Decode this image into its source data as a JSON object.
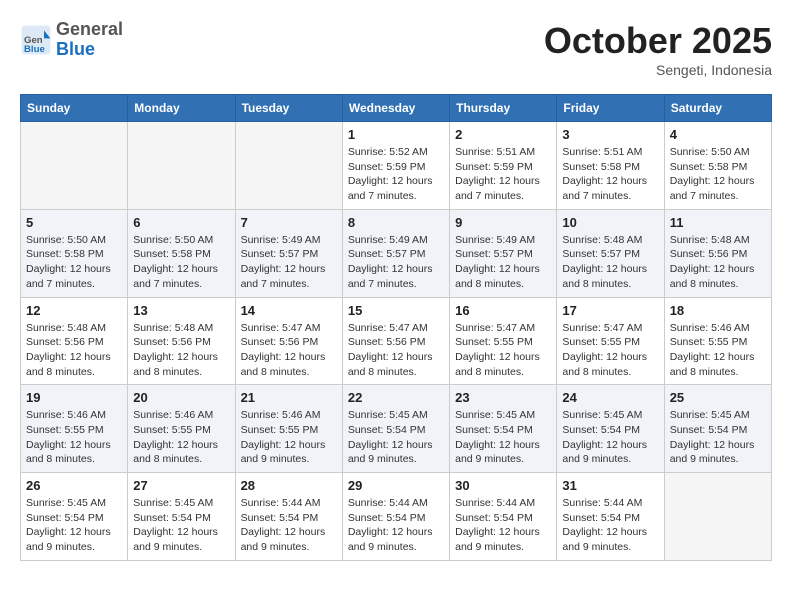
{
  "header": {
    "logo": {
      "general": "General",
      "blue": "Blue"
    },
    "title": "October 2025",
    "subtitle": "Sengeti, Indonesia"
  },
  "weekdays": [
    "Sunday",
    "Monday",
    "Tuesday",
    "Wednesday",
    "Thursday",
    "Friday",
    "Saturday"
  ],
  "weeks": [
    {
      "shaded": false,
      "days": [
        {
          "day": "",
          "info": ""
        },
        {
          "day": "",
          "info": ""
        },
        {
          "day": "",
          "info": ""
        },
        {
          "day": "1",
          "info": "Sunrise: 5:52 AM\nSunset: 5:59 PM\nDaylight: 12 hours\nand 7 minutes."
        },
        {
          "day": "2",
          "info": "Sunrise: 5:51 AM\nSunset: 5:59 PM\nDaylight: 12 hours\nand 7 minutes."
        },
        {
          "day": "3",
          "info": "Sunrise: 5:51 AM\nSunset: 5:58 PM\nDaylight: 12 hours\nand 7 minutes."
        },
        {
          "day": "4",
          "info": "Sunrise: 5:50 AM\nSunset: 5:58 PM\nDaylight: 12 hours\nand 7 minutes."
        }
      ]
    },
    {
      "shaded": true,
      "days": [
        {
          "day": "5",
          "info": "Sunrise: 5:50 AM\nSunset: 5:58 PM\nDaylight: 12 hours\nand 7 minutes."
        },
        {
          "day": "6",
          "info": "Sunrise: 5:50 AM\nSunset: 5:58 PM\nDaylight: 12 hours\nand 7 minutes."
        },
        {
          "day": "7",
          "info": "Sunrise: 5:49 AM\nSunset: 5:57 PM\nDaylight: 12 hours\nand 7 minutes."
        },
        {
          "day": "8",
          "info": "Sunrise: 5:49 AM\nSunset: 5:57 PM\nDaylight: 12 hours\nand 7 minutes."
        },
        {
          "day": "9",
          "info": "Sunrise: 5:49 AM\nSunset: 5:57 PM\nDaylight: 12 hours\nand 8 minutes."
        },
        {
          "day": "10",
          "info": "Sunrise: 5:48 AM\nSunset: 5:57 PM\nDaylight: 12 hours\nand 8 minutes."
        },
        {
          "day": "11",
          "info": "Sunrise: 5:48 AM\nSunset: 5:56 PM\nDaylight: 12 hours\nand 8 minutes."
        }
      ]
    },
    {
      "shaded": false,
      "days": [
        {
          "day": "12",
          "info": "Sunrise: 5:48 AM\nSunset: 5:56 PM\nDaylight: 12 hours\nand 8 minutes."
        },
        {
          "day": "13",
          "info": "Sunrise: 5:48 AM\nSunset: 5:56 PM\nDaylight: 12 hours\nand 8 minutes."
        },
        {
          "day": "14",
          "info": "Sunrise: 5:47 AM\nSunset: 5:56 PM\nDaylight: 12 hours\nand 8 minutes."
        },
        {
          "day": "15",
          "info": "Sunrise: 5:47 AM\nSunset: 5:56 PM\nDaylight: 12 hours\nand 8 minutes."
        },
        {
          "day": "16",
          "info": "Sunrise: 5:47 AM\nSunset: 5:55 PM\nDaylight: 12 hours\nand 8 minutes."
        },
        {
          "day": "17",
          "info": "Sunrise: 5:47 AM\nSunset: 5:55 PM\nDaylight: 12 hours\nand 8 minutes."
        },
        {
          "day": "18",
          "info": "Sunrise: 5:46 AM\nSunset: 5:55 PM\nDaylight: 12 hours\nand 8 minutes."
        }
      ]
    },
    {
      "shaded": true,
      "days": [
        {
          "day": "19",
          "info": "Sunrise: 5:46 AM\nSunset: 5:55 PM\nDaylight: 12 hours\nand 8 minutes."
        },
        {
          "day": "20",
          "info": "Sunrise: 5:46 AM\nSunset: 5:55 PM\nDaylight: 12 hours\nand 8 minutes."
        },
        {
          "day": "21",
          "info": "Sunrise: 5:46 AM\nSunset: 5:55 PM\nDaylight: 12 hours\nand 9 minutes."
        },
        {
          "day": "22",
          "info": "Sunrise: 5:45 AM\nSunset: 5:54 PM\nDaylight: 12 hours\nand 9 minutes."
        },
        {
          "day": "23",
          "info": "Sunrise: 5:45 AM\nSunset: 5:54 PM\nDaylight: 12 hours\nand 9 minutes."
        },
        {
          "day": "24",
          "info": "Sunrise: 5:45 AM\nSunset: 5:54 PM\nDaylight: 12 hours\nand 9 minutes."
        },
        {
          "day": "25",
          "info": "Sunrise: 5:45 AM\nSunset: 5:54 PM\nDaylight: 12 hours\nand 9 minutes."
        }
      ]
    },
    {
      "shaded": false,
      "days": [
        {
          "day": "26",
          "info": "Sunrise: 5:45 AM\nSunset: 5:54 PM\nDaylight: 12 hours\nand 9 minutes."
        },
        {
          "day": "27",
          "info": "Sunrise: 5:45 AM\nSunset: 5:54 PM\nDaylight: 12 hours\nand 9 minutes."
        },
        {
          "day": "28",
          "info": "Sunrise: 5:44 AM\nSunset: 5:54 PM\nDaylight: 12 hours\nand 9 minutes."
        },
        {
          "day": "29",
          "info": "Sunrise: 5:44 AM\nSunset: 5:54 PM\nDaylight: 12 hours\nand 9 minutes."
        },
        {
          "day": "30",
          "info": "Sunrise: 5:44 AM\nSunset: 5:54 PM\nDaylight: 12 hours\nand 9 minutes."
        },
        {
          "day": "31",
          "info": "Sunrise: 5:44 AM\nSunset: 5:54 PM\nDaylight: 12 hours\nand 9 minutes."
        },
        {
          "day": "",
          "info": ""
        }
      ]
    }
  ]
}
